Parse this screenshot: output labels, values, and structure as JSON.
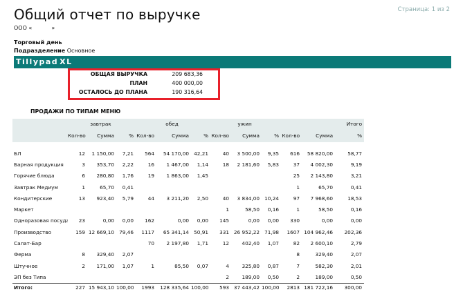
{
  "header": {
    "title": "Общий отчет по выручке",
    "page_indicator": "Страница: 1 из 2",
    "org_prefix": "ООО «",
    "org_suffix": "»"
  },
  "meta": {
    "trading_day_label": "Торговый день",
    "department_label": "Подразделение",
    "department_value": "Основное"
  },
  "brand": {
    "logo_text": "Tillypad",
    "logo_suffix": "XL",
    "band_color": "#0b7a78",
    "highlight_color": "#e8202a"
  },
  "summary": {
    "rows": [
      {
        "label": "ОБЩАЯ ВЫРУЧКА",
        "value": "209 683,36"
      },
      {
        "label": "ПЛАН",
        "value": "400 000,00"
      },
      {
        "label": "ОСТАЛОСЬ ДО ПЛАНА",
        "value": "190 316,64"
      }
    ]
  },
  "sales": {
    "section_title": "ПРОДАЖИ ПО ТИПАМ МЕНЮ",
    "groups": [
      "завтрак",
      "обед",
      "ужин",
      "Итого"
    ],
    "columns": [
      "Кол-во",
      "Сумма",
      "%",
      "Кол-во",
      "Сумма",
      "%",
      "Кол-во",
      "Сумма",
      "%",
      "Кол-во",
      "Сумма",
      "%",
      "%"
    ],
    "rows": [
      {
        "name": "БЛ",
        "cells": [
          "12",
          "1 150,00",
          "7,21",
          "564",
          "54 170,00",
          "42,21",
          "40",
          "3 500,00",
          "9,35",
          "616",
          "58 820,00",
          "58,77"
        ]
      },
      {
        "name": "Барная продукция",
        "cells": [
          "3",
          "353,70",
          "2,22",
          "16",
          "1 467,00",
          "1,14",
          "18",
          "2 181,60",
          "5,83",
          "37",
          "4 002,30",
          "9,19"
        ]
      },
      {
        "name": "Горячие блюда",
        "cells": [
          "6",
          "280,80",
          "1,76",
          "19",
          "1 863,00",
          "1,45",
          "",
          "",
          "",
          "25",
          "2 143,80",
          "3,21"
        ]
      },
      {
        "name": "Завтрак Медиум",
        "cells": [
          "1",
          "65,70",
          "0,41",
          "",
          "",
          "",
          "",
          "",
          "",
          "1",
          "65,70",
          "0,41"
        ]
      },
      {
        "name": "Кондитерские",
        "cells": [
          "13",
          "923,40",
          "5,79",
          "44",
          "3 211,20",
          "2,50",
          "40",
          "3 834,00",
          "10,24",
          "97",
          "7 968,60",
          "18,53"
        ]
      },
      {
        "name": "Маркет",
        "cells": [
          "",
          "",
          "",
          "",
          "",
          "",
          "1",
          "58,50",
          "0,16",
          "1",
          "58,50",
          "0,16"
        ]
      },
      {
        "name": "Одноразовая посуда",
        "cells": [
          "23",
          "0,00",
          "0,00",
          "162",
          "0,00",
          "0,00",
          "145",
          "0,00",
          "0,00",
          "330",
          "0,00",
          "0,00"
        ]
      },
      {
        "name": "Производство",
        "cells": [
          "159",
          "12 669,10",
          "79,46",
          "1117",
          "65 341,14",
          "50,91",
          "331",
          "26 952,22",
          "71,98",
          "1607",
          "104 962,46",
          "202,36"
        ]
      },
      {
        "name": "Салат-Бар",
        "cells": [
          "",
          "",
          "",
          "70",
          "2 197,80",
          "1,71",
          "12",
          "402,40",
          "1,07",
          "82",
          "2 600,10",
          "2,79"
        ]
      },
      {
        "name": "Ферма",
        "cells": [
          "8",
          "329,40",
          "2,07",
          "",
          "",
          "",
          "",
          "",
          "",
          "8",
          "329,40",
          "2,07"
        ]
      },
      {
        "name": "Штучное",
        "cells": [
          "2",
          "171,00",
          "1,07",
          "1",
          "85,50",
          "0,07",
          "4",
          "325,80",
          "0,87",
          "7",
          "582,30",
          "2,01"
        ]
      },
      {
        "name": "ЭП без Типа",
        "cells": [
          "",
          "",
          "",
          "",
          "",
          "",
          "2",
          "189,00",
          "0,50",
          "2",
          "189,00",
          "0,50"
        ]
      }
    ],
    "total": {
      "name": "Итого:",
      "cells": [
        "227",
        "15 943,10",
        "100,00",
        "1993",
        "128 335,64",
        "100,00",
        "593",
        "37 443,42",
        "100,00",
        "2813",
        "181 722,16",
        "300,00"
      ]
    }
  }
}
